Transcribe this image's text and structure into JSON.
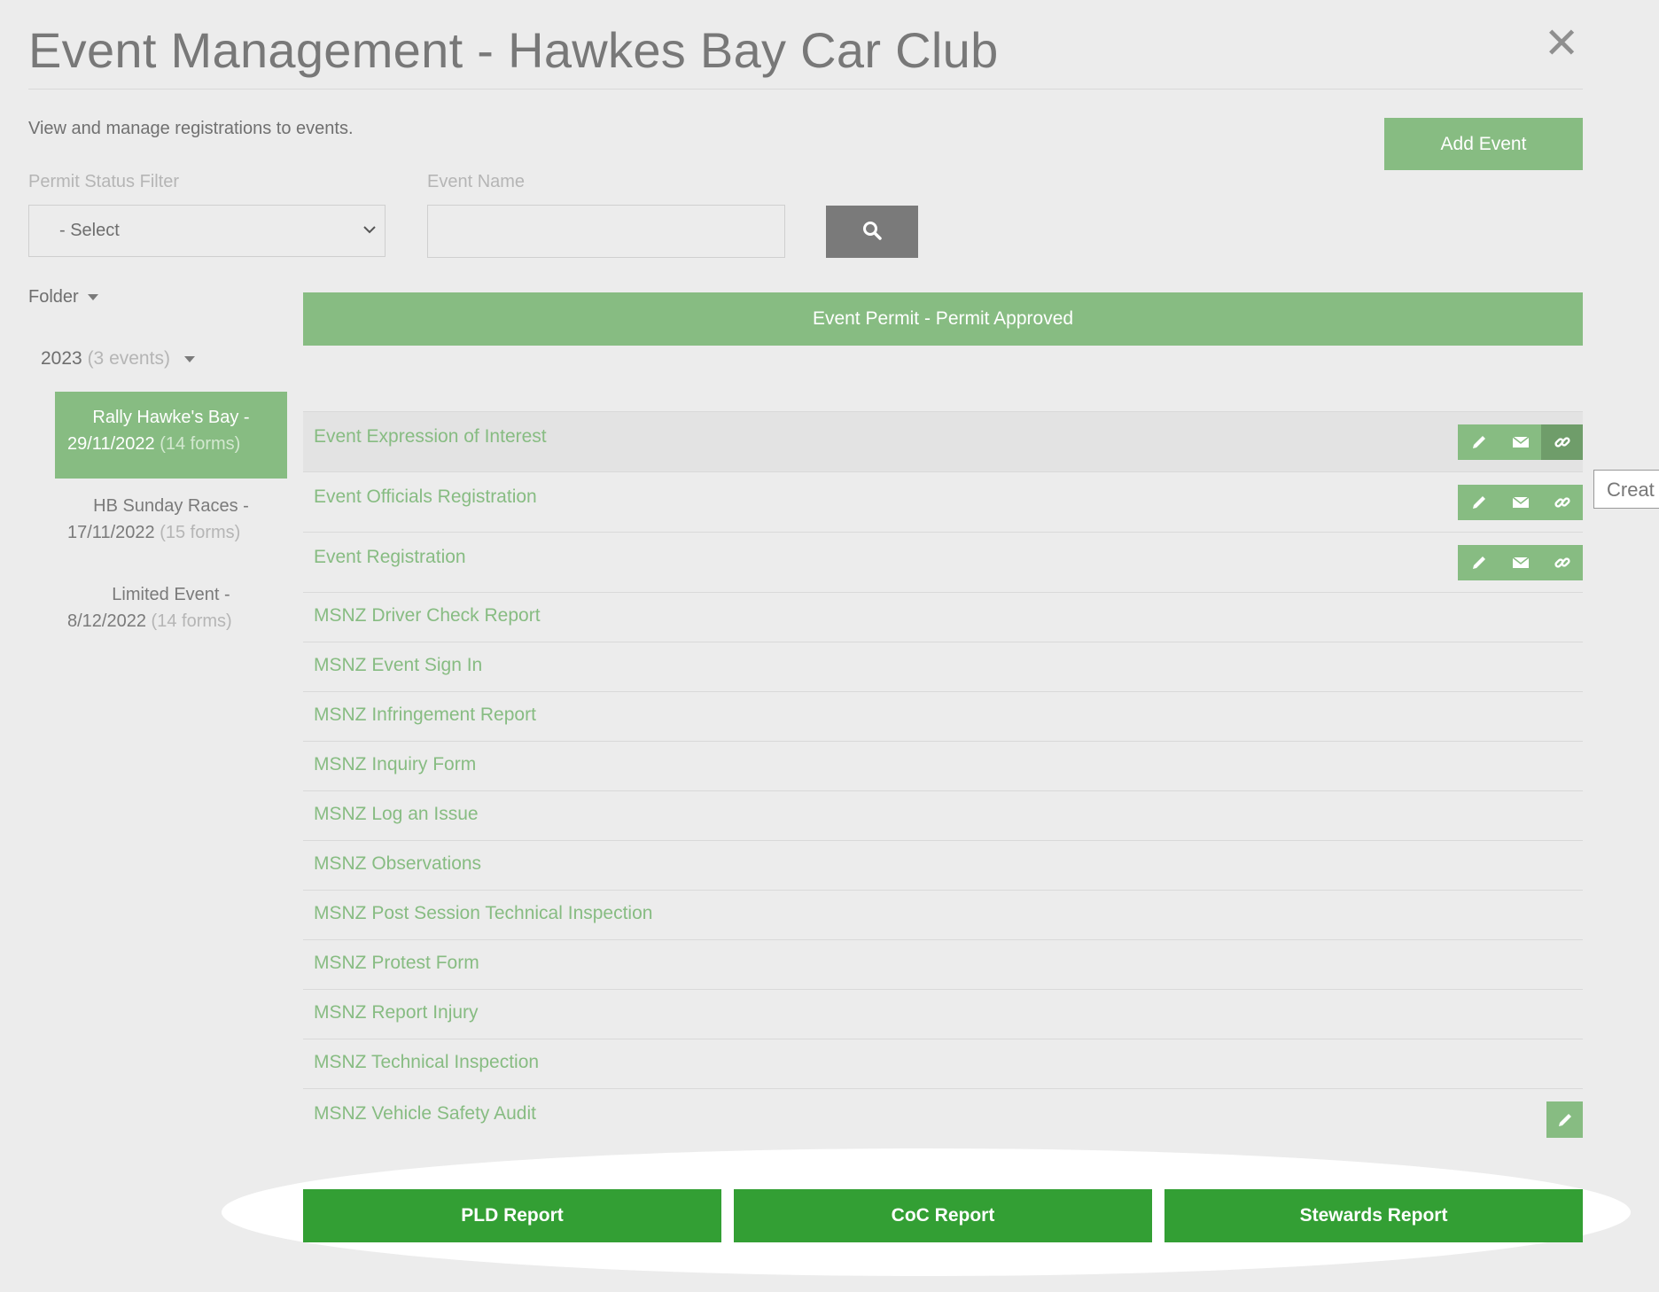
{
  "header": {
    "title": "Event Management - Hawkes Bay Car Club",
    "close_icon": "close-icon",
    "subtitle": "View and manage registrations to events.",
    "add_event_label": "Add Event"
  },
  "filters": {
    "permit_status_label": "Permit Status Filter",
    "permit_status_value": "- Select",
    "event_name_label": "Event Name",
    "event_name_value": "",
    "search_icon": "search-icon"
  },
  "sidebar": {
    "folder_label": "Folder",
    "year": {
      "label": "2023",
      "count": "(3 events)"
    },
    "events": [
      {
        "line1": "Rally Hawke's Bay -",
        "line2": "29/11/2022",
        "forms": "(14 forms)",
        "active": true
      },
      {
        "line1": "HB Sunday Races -",
        "line2": "17/11/2022",
        "forms": "(15 forms)",
        "active": false
      },
      {
        "line1": "Limited Event -",
        "line2": "8/12/2022",
        "forms": "(14 forms)",
        "active": false
      }
    ]
  },
  "main": {
    "permit_status": "Event Permit - Permit Approved",
    "forms": [
      {
        "name": "Event Expression of Interest",
        "actions": [
          "edit",
          "email",
          "link"
        ]
      },
      {
        "name": "Event Officials Registration",
        "actions": [
          "edit",
          "email",
          "link"
        ]
      },
      {
        "name": "Event Registration",
        "actions": [
          "edit",
          "email",
          "link"
        ]
      },
      {
        "name": "MSNZ Driver Check Report",
        "actions": []
      },
      {
        "name": "MSNZ Event Sign In",
        "actions": []
      },
      {
        "name": "MSNZ Infringement Report",
        "actions": []
      },
      {
        "name": "MSNZ Inquiry Form",
        "actions": []
      },
      {
        "name": "MSNZ Log an Issue",
        "actions": []
      },
      {
        "name": "MSNZ Observations",
        "actions": []
      },
      {
        "name": "MSNZ Post Session Technical Inspection",
        "actions": []
      },
      {
        "name": "MSNZ Protest Form",
        "actions": []
      },
      {
        "name": "MSNZ Report Injury",
        "actions": []
      },
      {
        "name": "MSNZ Technical Inspection",
        "actions": []
      },
      {
        "name": "MSNZ Vehicle Safety Audit",
        "actions": [
          "edit"
        ]
      }
    ],
    "tooltip": "Creat"
  },
  "reports": {
    "pld": "PLD Report",
    "coc": "CoC Report",
    "stewards": "Stewards Report"
  },
  "colors": {
    "accent_green": "#87bc82",
    "report_green": "#339f34",
    "search_gray": "#7a7a7a"
  }
}
